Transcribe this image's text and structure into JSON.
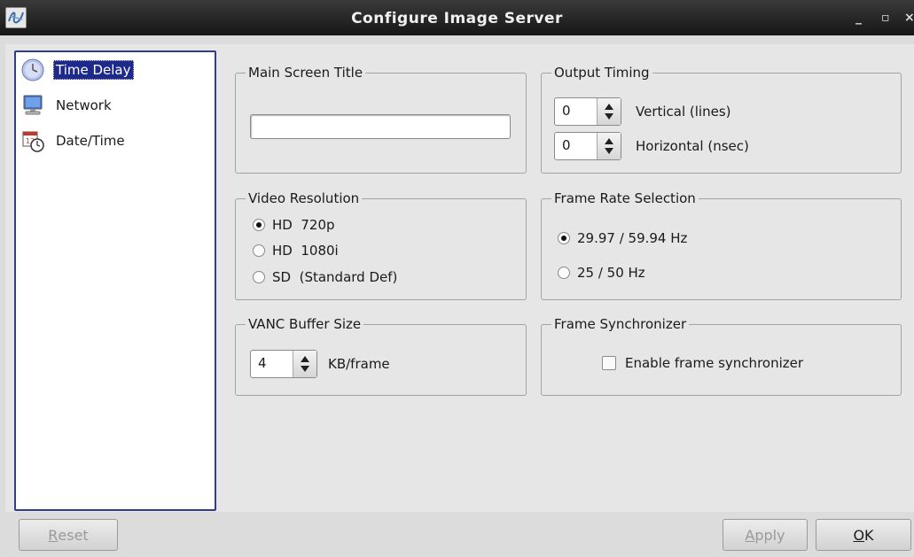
{
  "window": {
    "title": "Configure Image Server",
    "app_icon": "app-logo-icon",
    "minimize": "_",
    "maximize": "▫",
    "close": "×"
  },
  "nav": {
    "items": [
      {
        "label": "Time Delay",
        "icon": "clock-icon",
        "selected": true
      },
      {
        "label": "Network",
        "icon": "monitor-icon",
        "selected": false
      },
      {
        "label": "Date/Time",
        "icon": "calendar-clock-icon",
        "selected": false
      }
    ]
  },
  "main_screen_title": {
    "group_title": "Main Screen Title",
    "value": ""
  },
  "output_timing": {
    "group_title": "Output Timing",
    "vertical_value": "0",
    "vertical_label": "Vertical (lines)",
    "horizontal_value": "0",
    "horizontal_label": "Horizontal (nsec)"
  },
  "video_resolution": {
    "group_title": "Video Resolution",
    "options": [
      "HD  720p",
      "HD  1080i",
      "SD  (Standard Def)"
    ],
    "selected_index": 0
  },
  "frame_rate": {
    "group_title": "Frame Rate Selection",
    "options": [
      "29.97 / 59.94 Hz",
      "25 / 50 Hz"
    ],
    "selected_index": 0
  },
  "vanc": {
    "group_title": "VANC Buffer Size",
    "value": "4",
    "unit_label": "KB/frame"
  },
  "frame_sync": {
    "group_title": "Frame Synchronizer",
    "checkbox_label": "Enable frame synchronizer",
    "checked": false
  },
  "buttons": {
    "reset_mnemonic": "R",
    "reset_rest": "eset",
    "apply_mnemonic": "A",
    "apply_rest": "pply",
    "ok_mnemonic": "O",
    "ok_rest": "K"
  }
}
